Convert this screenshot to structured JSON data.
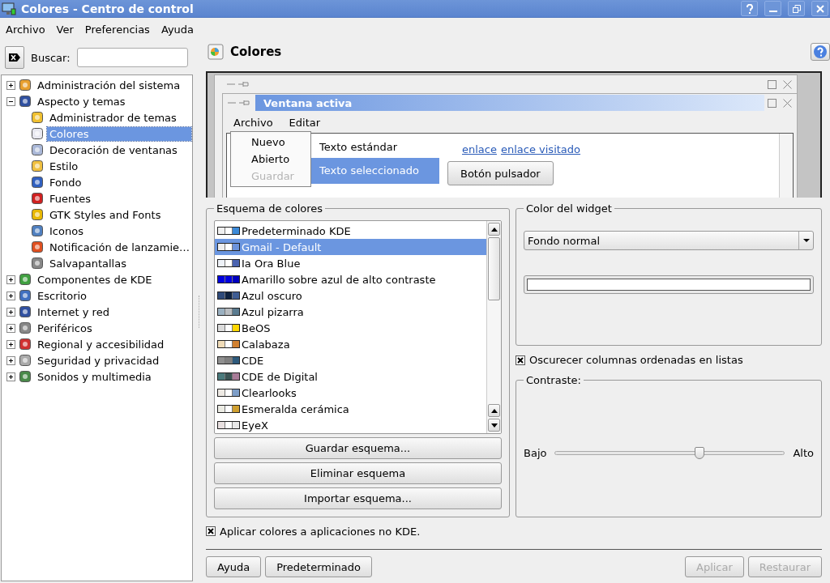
{
  "window": {
    "title": "Colores - Centro de control"
  },
  "menu": [
    "Archivo",
    "Ver",
    "Preferencias",
    "Ayuda"
  ],
  "search": {
    "label": "Buscar:"
  },
  "tree": [
    {
      "label": "Administración del sistema",
      "expanded": false,
      "selected": false
    },
    {
      "label": "Aspecto y temas",
      "expanded": true,
      "selected": false,
      "children": [
        {
          "label": "Administrador de temas",
          "selected": false
        },
        {
          "label": "Colores",
          "selected": true
        },
        {
          "label": "Decoración de ventanas",
          "selected": false
        },
        {
          "label": "Estilo",
          "selected": false
        },
        {
          "label": "Fondo",
          "selected": false
        },
        {
          "label": "Fuentes",
          "selected": false
        },
        {
          "label": "GTK Styles and Fonts",
          "selected": false
        },
        {
          "label": "Iconos",
          "selected": false
        },
        {
          "label": "Notificación de lanzamie…",
          "selected": false
        },
        {
          "label": "Salvapantallas",
          "selected": false
        }
      ]
    },
    {
      "label": "Componentes de KDE",
      "expanded": false,
      "selected": false
    },
    {
      "label": "Escritorio",
      "expanded": false,
      "selected": false
    },
    {
      "label": "Internet y red",
      "expanded": false,
      "selected": false
    },
    {
      "label": "Periféricos",
      "expanded": false,
      "selected": false
    },
    {
      "label": "Regional y accesibilidad",
      "expanded": false,
      "selected": false
    },
    {
      "label": "Seguridad y privacidad",
      "expanded": false,
      "selected": false
    },
    {
      "label": "Sonidos y multimedia",
      "expanded": false,
      "selected": false
    }
  ],
  "module": {
    "title": "Colores"
  },
  "preview": {
    "active_title": "Ventana activa",
    "menu": [
      "Archivo",
      "Editar"
    ],
    "popup": [
      {
        "label": "Nuevo",
        "disabled": false
      },
      {
        "label": "Abierto",
        "disabled": false
      },
      {
        "label": "Guardar",
        "disabled": true
      }
    ],
    "standard_text": "Texto estándar",
    "selected_text": "Texto seleccionado",
    "link": "enlace",
    "visited_link": "enlace visitado",
    "button": "Botón pulsador"
  },
  "scheme_group": {
    "title": "Esquema de colores",
    "schemes": [
      {
        "name": "Predeterminado KDE",
        "selected": false,
        "swatch": [
          {
            "color": "#f0f0f0"
          },
          {
            "color": "#ffffff"
          },
          {
            "color": "#3c8ad8"
          }
        ]
      },
      {
        "name": "Gmail - Default",
        "selected": true,
        "swatch": [
          {
            "color": "#eeeeee"
          },
          {
            "color": "#ffffff"
          },
          {
            "color": "#6c93dc"
          }
        ]
      },
      {
        "name": "Ia Ora Blue",
        "selected": false,
        "swatch": [
          {
            "color": "#eef2f8"
          },
          {
            "color": "#ffffff"
          },
          {
            "color": "#4a63b0"
          }
        ]
      },
      {
        "name": "Amarillo sobre azul de alto contraste",
        "selected": false,
        "swatch": [
          {
            "color": "#0000e0"
          },
          {
            "color": "#0000e0"
          },
          {
            "color": "#0000c0"
          }
        ]
      },
      {
        "name": "Azul oscuro",
        "selected": false,
        "swatch": [
          {
            "color": "#2e4a7a"
          },
          {
            "color": "#0e2240"
          },
          {
            "color": "#3f5d93"
          }
        ]
      },
      {
        "name": "Azul pizarra",
        "selected": false,
        "swatch": [
          {
            "color": "#9ab0c0"
          },
          {
            "color": "#b8bcc0"
          },
          {
            "color": "#5a7b90"
          }
        ]
      },
      {
        "name": "BeOS",
        "selected": false,
        "swatch": [
          {
            "color": "#dcdcdc"
          },
          {
            "color": "#ffffff"
          },
          {
            "color": "#ffd700"
          }
        ]
      },
      {
        "name": "Calabaza",
        "selected": false,
        "swatch": [
          {
            "color": "#f0dcb8"
          },
          {
            "color": "#ffffff"
          },
          {
            "color": "#d08030"
          }
        ]
      },
      {
        "name": "CDE",
        "selected": false,
        "swatch": [
          {
            "color": "#909090"
          },
          {
            "color": "#808080"
          },
          {
            "color": "#2e5a7c"
          }
        ]
      },
      {
        "name": "CDE de Digital",
        "selected": false,
        "swatch": [
          {
            "color": "#4a7a7c"
          },
          {
            "color": "#3a5454"
          },
          {
            "color": "#a87c98"
          }
        ]
      },
      {
        "name": "Clearlooks",
        "selected": false,
        "swatch": [
          {
            "color": "#eeeae4"
          },
          {
            "color": "#ffffff"
          },
          {
            "color": "#7d9ec8"
          }
        ]
      },
      {
        "name": "Esmeralda cerámica",
        "selected": false,
        "swatch": [
          {
            "color": "#ecece4"
          },
          {
            "color": "#ffffff"
          },
          {
            "color": "#d0a030"
          }
        ]
      },
      {
        "name": "EyeX",
        "selected": false,
        "swatch": [
          {
            "color": "#e8e0e0"
          },
          {
            "color": "#ffffff"
          },
          {
            "color": "#e8e8e8"
          }
        ]
      }
    ],
    "buttons": [
      "Guardar esquema...",
      "Eliminar esquema",
      "Importar esquema..."
    ]
  },
  "widget_group": {
    "title": "Color del widget",
    "role": "Fondo normal",
    "color": "#ffffff"
  },
  "sort_checkbox": {
    "label": "Oscurecer columnas ordenadas en listas",
    "checked": true
  },
  "contrast": {
    "title": "Contraste:",
    "low": "Bajo",
    "high": "Alto",
    "level": 0.63
  },
  "apply_checkbox": {
    "label": "Aplicar colores a aplicaciones no KDE.",
    "checked": true
  },
  "left_buttons": [
    {
      "label": "Ayuda",
      "disabled": false
    },
    {
      "label": "Predeterminado",
      "disabled": false
    }
  ],
  "right_buttons": [
    {
      "label": "Aplicar",
      "disabled": true
    },
    {
      "label": "Restaurar",
      "disabled": true
    }
  ]
}
